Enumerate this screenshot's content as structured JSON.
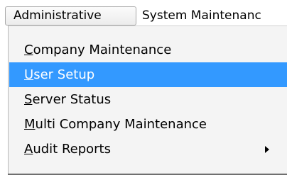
{
  "menubar": {
    "items": [
      {
        "label": "Administrative"
      },
      {
        "label": "System Maintenanc"
      }
    ]
  },
  "dropdown": {
    "items": [
      {
        "mnemonic": "C",
        "rest": "ompany Maintenance"
      },
      {
        "mnemonic": "U",
        "rest": "ser Setup"
      },
      {
        "mnemonic": "S",
        "rest": "erver Status"
      },
      {
        "mnemonic": "M",
        "rest": "ulti Company Maintenance"
      },
      {
        "mnemonic": "A",
        "rest": "udit Reports"
      }
    ],
    "highlight_color": "#3399ff",
    "submenu_icon": "submenu-arrow-icon"
  }
}
